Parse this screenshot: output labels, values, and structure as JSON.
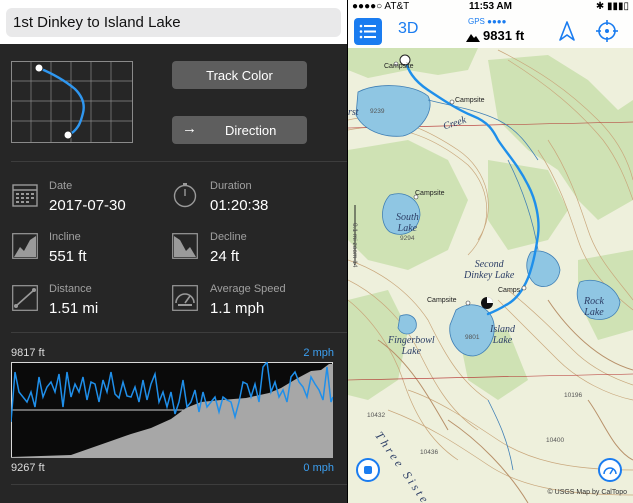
{
  "track": {
    "title": "1st Dinkey to Island Lake",
    "track_color_label": "Track Color",
    "direction_label": "Direction",
    "direction_arrow": "→"
  },
  "stats": {
    "date_label": "Date",
    "date_value": "2017-07-30",
    "duration_label": "Duration",
    "duration_value": "01:20:38",
    "incline_label": "Incline",
    "incline_value": "551 ft",
    "decline_label": "Decline",
    "decline_value": "24 ft",
    "distance_label": "Distance",
    "distance_value": "1.51 mi",
    "avgspeed_label": "Average Speed",
    "avgspeed_value": "1.1 mph"
  },
  "profile": {
    "elev_max": "9817 ft",
    "elev_min": "9267 ft",
    "speed_max": "2 mph",
    "speed_min": "0 mph"
  },
  "map": {
    "status": {
      "carrier": "●●●●○ AT&T",
      "time": "11:53 AM",
      "battery": "✱ ▮▮▮▯"
    },
    "toolbar": {
      "view_3d": "3D",
      "gps_label": "GPS ●●●●",
      "elevation": "9831 ft"
    },
    "labels": {
      "campsite": "Campsite",
      "campsite_short": "Camps",
      "creek": "Creek",
      "south_lake": "South\nLake",
      "second_dinkey": "Second\nDinkey Lake",
      "rock_lake": "Rock\nLake",
      "fingerbowl": "Fingerbowl\nLake",
      "island_lake": "Island\nLake",
      "three_sisters": "Three Sisters",
      "first_partial": "rst",
      "scale_bar": "0.1 mi zoom 14",
      "e9239": "9239",
      "e9294": "9294",
      "e9801": "9801",
      "e10196": "10196",
      "e10432": "10432",
      "e10436": "10436",
      "e10400": "10400"
    },
    "credit": "© USGS Map by CalTopo"
  },
  "colors": {
    "accent": "#1a7cf0",
    "track": "#1f8fea",
    "panel": "#262626"
  }
}
